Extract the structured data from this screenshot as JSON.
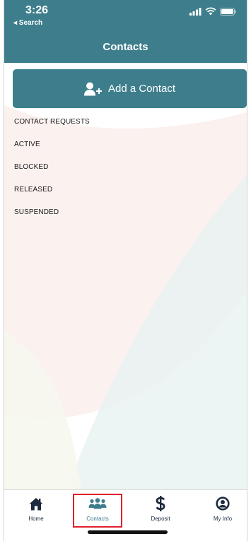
{
  "status_bar": {
    "time": "3:26",
    "back_label": "◂ Search"
  },
  "nav": {
    "title": "Contacts"
  },
  "add_contact": {
    "label": "Add a Contact",
    "icon": "add-user-icon"
  },
  "menu": {
    "items": [
      {
        "label": "CONTACT REQUESTS"
      },
      {
        "label": "ACTIVE"
      },
      {
        "label": "BLOCKED"
      },
      {
        "label": "RELEASED"
      },
      {
        "label": "SUSPENDED"
      }
    ]
  },
  "tabs": [
    {
      "label": "Home",
      "icon": "home-icon"
    },
    {
      "label": "Contacts",
      "icon": "people-icon",
      "active": true
    },
    {
      "label": "Deposit",
      "icon": "dollar-icon"
    },
    {
      "label": "My Info",
      "icon": "user-circle-icon"
    }
  ],
  "colors": {
    "brand": "#3e7e8c",
    "highlight_box": "#e01e2b",
    "tab_icon": "#1d2a3d"
  }
}
